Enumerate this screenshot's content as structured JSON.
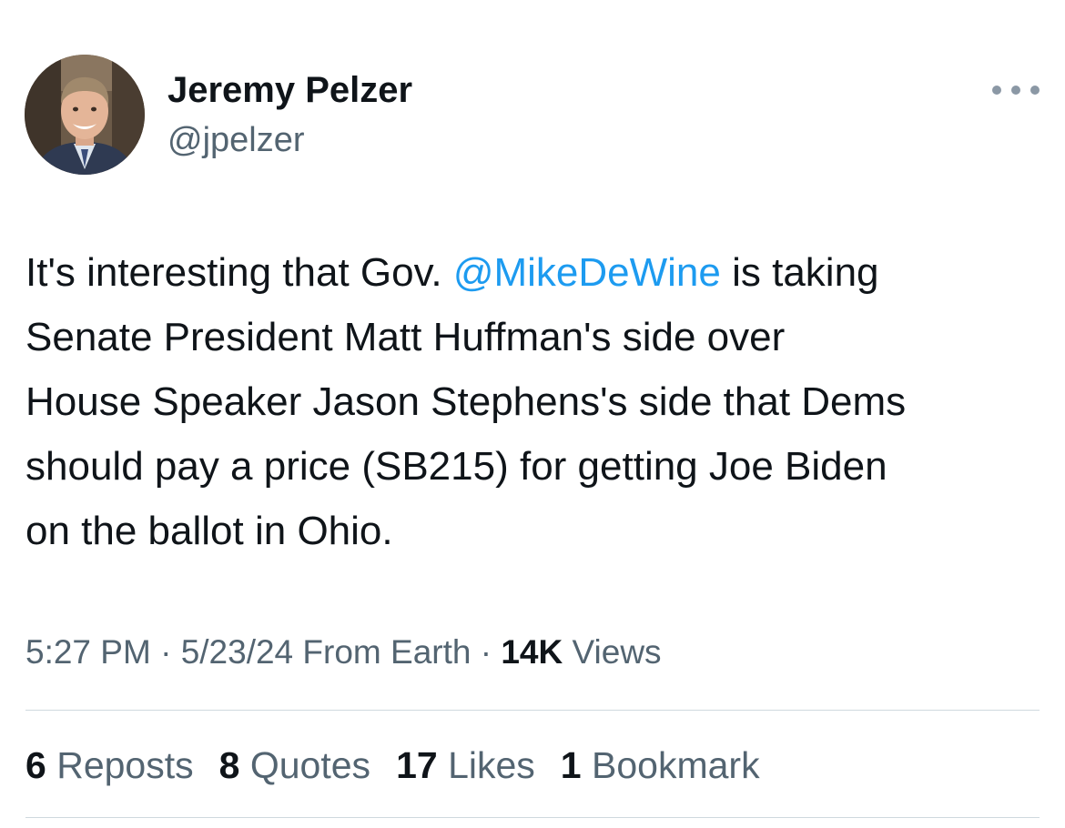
{
  "author": {
    "name": "Jeremy Pelzer",
    "handle": "@jpelzer",
    "avatar_icon": "profile-photo"
  },
  "more_icon": "ellipsis-icon",
  "tweet": {
    "segments": {
      "line1_prefix": "It's interesting that Gov. ",
      "mention": "@MikeDeWine",
      "line1_suffix": " is taking",
      "line2": "Senate President Matt Huffman's side over",
      "line3": "House Speaker Jason Stephens's side that Dems",
      "line4": "should pay a price (SB215) for getting Joe Biden",
      "line5": "on the ballot in Ohio."
    }
  },
  "meta": {
    "time": "5:27 PM",
    "sep1": " · ",
    "date": "5/23/24",
    "source": " From Earth",
    "sep2": " · ",
    "views_count": "14K",
    "views_label": " Views"
  },
  "stats": [
    {
      "count": "6",
      "label": "Reposts"
    },
    {
      "count": "8",
      "label": "Quotes"
    },
    {
      "count": "17",
      "label": "Likes"
    },
    {
      "count": "1",
      "label": "Bookmark"
    }
  ],
  "colors": {
    "text": "#0f1419",
    "secondary": "#536471",
    "link": "#1d9bf0",
    "divider": "#cfd9de"
  }
}
